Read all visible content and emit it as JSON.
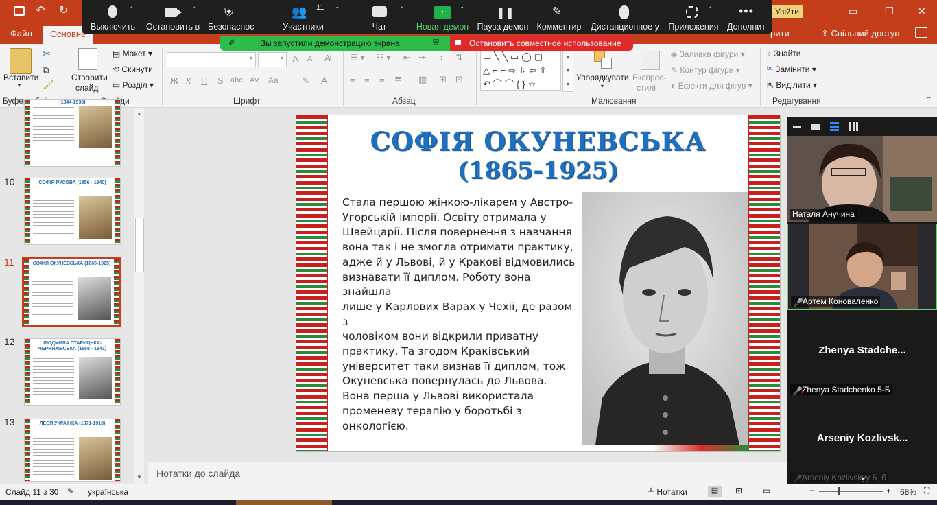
{
  "titlebar": {
    "login_label": "Увійти",
    "share_label": "Спільний доступ"
  },
  "tabs": [
    {
      "label": "Файл"
    },
    {
      "label": "Основне"
    }
  ],
  "tabs_partial_right": "рити",
  "zoom_toolbar": {
    "items": [
      {
        "label": "Выключить",
        "icon": "microphone-icon"
      },
      {
        "label": "Остановить в",
        "icon": "video-camera-icon"
      },
      {
        "label": "Безопаснос",
        "icon": "shield-icon"
      },
      {
        "label": "Участники",
        "icon": "participants-icon",
        "count": "11"
      },
      {
        "label": "Чат",
        "icon": "chat-icon"
      },
      {
        "label": "Новая демон",
        "icon": "share-screen-icon"
      },
      {
        "label": "Пауза демон",
        "icon": "pause-icon"
      },
      {
        "label": "Комментир",
        "icon": "annotate-icon"
      },
      {
        "label": "Дистанционное у",
        "icon": "remote-control-icon"
      },
      {
        "label": "Приложения",
        "icon": "apps-icon"
      },
      {
        "label": "Дополнит",
        "icon": "more-icon"
      }
    ],
    "share_banner": "Вы запустили демонстрацию экрана",
    "stop_banner": "Остановить совместное использование"
  },
  "ribbon": {
    "clipboard": {
      "paste": "Вставити",
      "group": "Буфер обміну"
    },
    "slides": {
      "new_slide": "Створити слайд",
      "new_slide_l1": "Створити",
      "new_slide_l2": "слайд",
      "layout": "Макет",
      "reset": "Скинути",
      "section": "Розділ",
      "group": "Слайди"
    },
    "font": {
      "group": "Шрифт",
      "bold": "Ж",
      "italic": "К",
      "underline": "П",
      "strike": "S",
      "abc": "abc",
      "spacing": "AV",
      "case": "Aa",
      "grow": "A",
      "shrink": "A",
      "color": "A"
    },
    "paragraph": {
      "group": "Абзац"
    },
    "drawing": {
      "arrange": "Упорядкувати",
      "quick_styles_l1": "Експрес-",
      "quick_styles_l2": "стилі",
      "fill": "Заливка фігури",
      "outline": "Контур фігури",
      "effects": "Ефекти для фігур",
      "group": "Малювання"
    },
    "editing": {
      "find": "Знайти",
      "replace": "Замінити",
      "select": "Виділити",
      "group": "Редагування"
    }
  },
  "thumbnails": [
    {
      "num": "",
      "title": "(1844-1930)",
      "photo": "color"
    },
    {
      "num": "10",
      "title": "СОФІЯ РУСОВА (1856 - 1940)",
      "photo": "color"
    },
    {
      "num": "11",
      "title": "СОФІЯ ОКУНЕВСЬКА (1865-1925)",
      "photo": "bw",
      "selected": true
    },
    {
      "num": "12",
      "title": "ЛЮДМИЛА СТАРИЦЬКА-ЧЕРНЯХІВСЬКА (1868 - 1941)",
      "photo": "bw"
    },
    {
      "num": "13",
      "title": "ЛЕСЯ УКРАЇНКА (1871-1913)",
      "photo": "color"
    }
  ],
  "slide": {
    "title": "СОФІЯ ОКУНЕВСЬКА",
    "years": "(1865-1925)",
    "body": "Стала першою жінкою-лікарем у Австро-\nУгорській імперії. Освіту отримала у\nШвейцарії. Після повернення з навчання\nвона так і не змогла отримати практику,\nадже й у Львові, й у Кракові відмовились\nвизнавати її диплом. Роботу вона знайшла\nлише у Карлових Варах у Чехії, де разом з\nчоловіком вони відкрили приватну\nпрактику. Та згодом Краківський\nуніверситет таки визнав її диплом, тож\nОкуневська повернулась до Львова.\nВона перша у Львові використала\nпроменеву терапію у боротьбі з\nонкологією."
  },
  "notes_placeholder": "Нотатки до слайда",
  "status": {
    "slide_info": "Слайд 11 з 30",
    "language": "українська",
    "notes_btn": "Нотатки",
    "zoom": "68%"
  },
  "participants": [
    {
      "name": "Наталя Анучина",
      "muted": false,
      "video": true
    },
    {
      "name": "Артем Коноваленко",
      "muted": true,
      "video": true
    },
    {
      "display": "Zhenya  Stadche...",
      "name": "Zhenya Stadchenko 5-Б",
      "muted": true,
      "video": false
    },
    {
      "display": "Arseniy  Kozlivsk...",
      "name": "Arseniy Kozlivskyy 5_б",
      "muted": true,
      "video": false
    }
  ],
  "colors": {
    "accent": "#c43e1c",
    "title_blue": "#1e6fbf",
    "zoom_green": "#2dbb4a",
    "zoom_red": "#e02a2a"
  }
}
